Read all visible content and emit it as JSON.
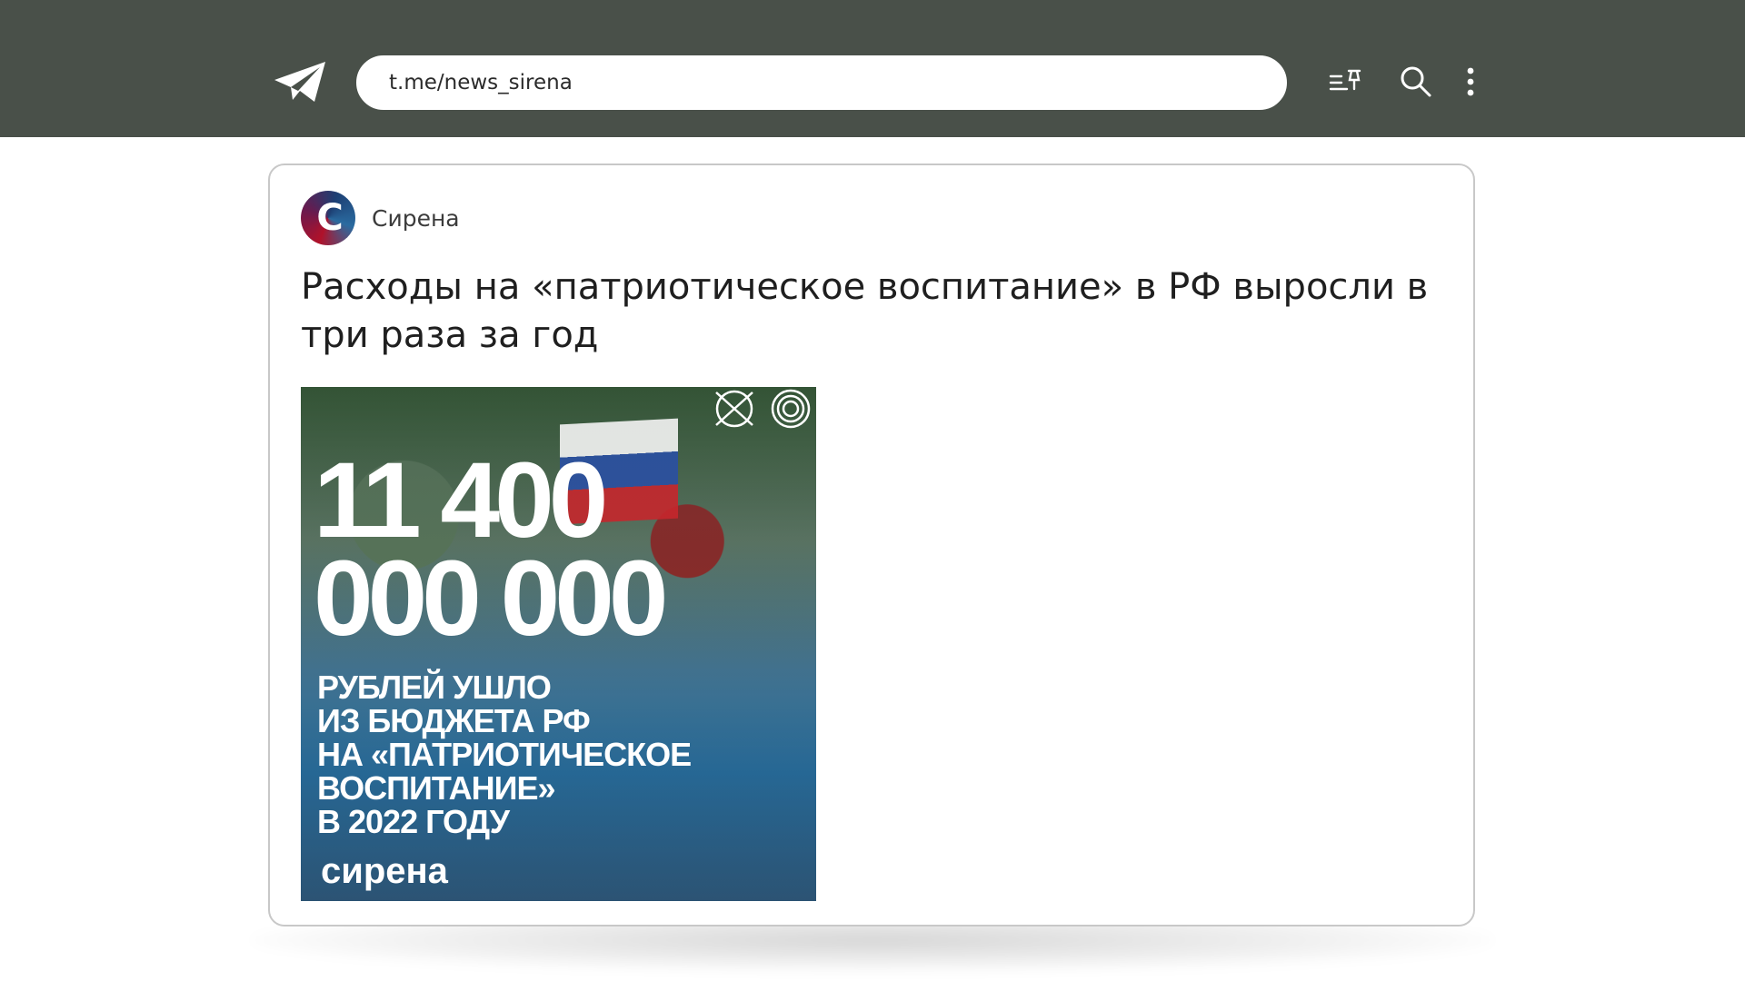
{
  "browser": {
    "url": "t.me/news_sirena"
  },
  "post": {
    "channel_name": "Сирена",
    "avatar_letter": "C",
    "title": "Расходы на «патриотическое воспитание» в РФ выросли в три раза за год",
    "image": {
      "number_line1": "11 400",
      "number_line2": "000 000",
      "caption_lines": [
        "РУБЛЕЙ УШЛО",
        "ИЗ БЮДЖЕТА РФ",
        "НА «ПАТРИОТИЧЕСКОЕ",
        "ВОСПИТАНИЕ»",
        "В 2022 ГОДУ"
      ],
      "brand": "сирена"
    }
  },
  "icons": {
    "telegram": "telegram-logo-icon",
    "pins": "pinned-list-icon",
    "search": "search-icon",
    "more": "more-vertical-icon"
  },
  "colors": {
    "topbar": "#495049",
    "card_border": "#c8c8c8"
  }
}
